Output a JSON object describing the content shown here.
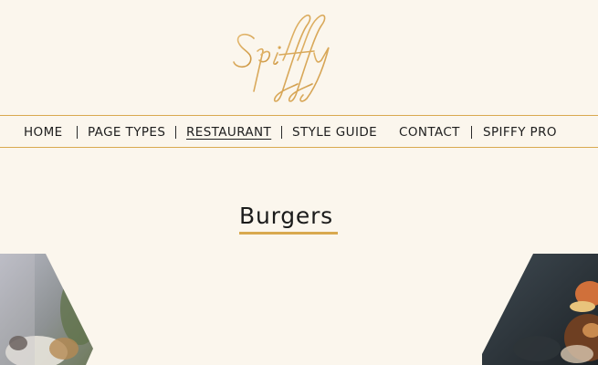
{
  "brand": {
    "logo_text": "Spiffy",
    "accent_color": "#d9a94f",
    "background_color": "#fbf6ed"
  },
  "nav": {
    "items": [
      {
        "label": "HOME",
        "active": false
      },
      {
        "label": "PAGE TYPES",
        "active": false
      },
      {
        "label": "RESTAURANT",
        "active": true
      },
      {
        "label": "STYLE GUIDE",
        "active": false
      },
      {
        "label": "CONTACT",
        "active": false
      },
      {
        "label": "SPIFFY PRO",
        "active": false
      }
    ]
  },
  "main": {
    "title": "Burgers"
  }
}
